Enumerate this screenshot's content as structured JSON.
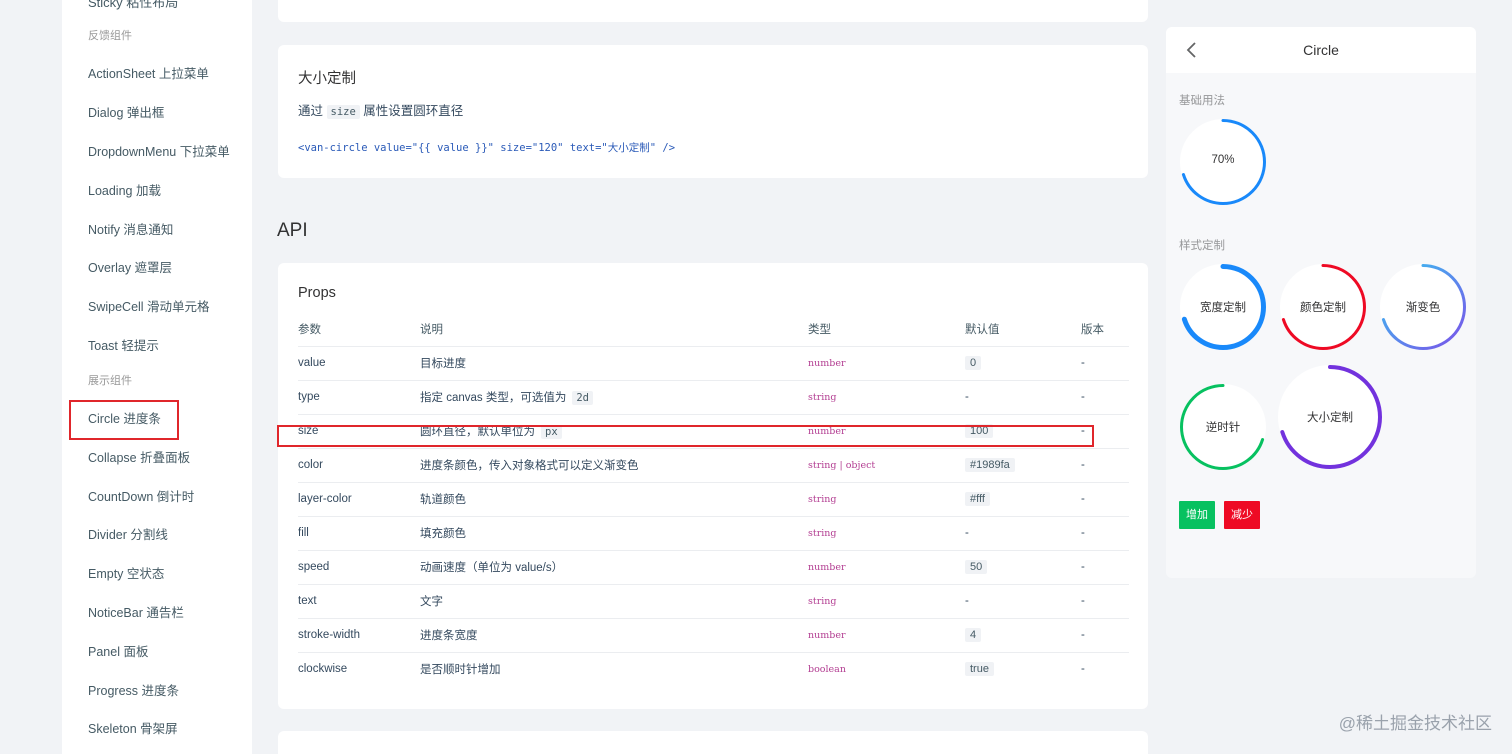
{
  "sidebar": {
    "top_item_clip": "Sticky 粘性布局",
    "group_feedback": "反馈组件",
    "feedback_items": [
      "ActionSheet 上拉菜单",
      "Dialog 弹出框",
      "DropdownMenu 下拉菜单",
      "Loading 加载",
      "Notify 消息通知",
      "Overlay 遮罩层",
      "SwipeCell 滑动单元格",
      "Toast 轻提示"
    ],
    "group_display": "展示组件",
    "display_items": [
      "Circle 进度条",
      "Collapse 折叠面板",
      "CountDown 倒计时",
      "Divider 分割线",
      "Empty 空状态",
      "NoticeBar 通告栏",
      "Panel 面板",
      "Progress 进度条",
      "Skeleton 骨架屏"
    ]
  },
  "size_card": {
    "title": "大小定制",
    "desc_prefix": "通过",
    "desc_code": "size",
    "desc_suffix": "属性设置圆环直径",
    "code": "<van-circle value=\"{{ value }}\" size=\"120\" text=\"大小定制\" />"
  },
  "api": {
    "title": "API",
    "props_title": "Props",
    "headers": [
      "参数",
      "说明",
      "类型",
      "默认值",
      "版本"
    ],
    "rows": [
      {
        "name": "value",
        "desc": "目标进度",
        "desc_code": "",
        "type": "number",
        "default": "0",
        "default_chip": true,
        "version": "-"
      },
      {
        "name": "type",
        "desc": "指定 canvas 类型，可选值为",
        "desc_code": "2d",
        "type": "string",
        "default": "-",
        "default_chip": false,
        "version": "-"
      },
      {
        "name": "size",
        "desc": "圆环直径，默认单位为",
        "desc_code": "px",
        "type": "number",
        "default": "100",
        "default_chip": true,
        "version": "-"
      },
      {
        "name": "color",
        "desc": "进度条颜色，传入对象格式可以定义渐变色",
        "desc_code": "",
        "type": "string | object",
        "default": "#1989fa",
        "default_chip": true,
        "version": "-"
      },
      {
        "name": "layer-color",
        "desc": "轨道颜色",
        "desc_code": "",
        "type": "string",
        "default": "#fff",
        "default_chip": true,
        "version": "-"
      },
      {
        "name": "fill",
        "desc": "填充颜色",
        "desc_code": "",
        "type": "string",
        "default": "-",
        "default_chip": false,
        "version": "-"
      },
      {
        "name": "speed",
        "desc": "动画速度（单位为 value/s）",
        "desc_code": "",
        "type": "number",
        "default": "50",
        "default_chip": true,
        "version": "-"
      },
      {
        "name": "text",
        "desc": "文字",
        "desc_code": "",
        "type": "string",
        "default": "-",
        "default_chip": false,
        "version": "-"
      },
      {
        "name": "stroke-width",
        "desc": "进度条宽度",
        "desc_code": "",
        "type": "number",
        "default": "4",
        "default_chip": true,
        "version": "-"
      },
      {
        "name": "clockwise",
        "desc": "是否顺时针增加",
        "desc_code": "",
        "type": "boolean",
        "default": "true",
        "default_chip": true,
        "version": "-"
      }
    ]
  },
  "phone": {
    "title": "Circle",
    "back_icon": "chevron-left-icon",
    "section_basic": "基础用法",
    "section_custom": "样式定制",
    "circles": [
      {
        "text": "70%",
        "value": 70,
        "color": "#1989fa"
      },
      {
        "text": "宽度定制",
        "value": 70,
        "color": "#1989fa"
      },
      {
        "text": "颜色定制",
        "value": 70,
        "color": "#ee0a24"
      },
      {
        "text": "渐变色",
        "value": 70,
        "color": "#6f6ef6"
      },
      {
        "text": "逆时针",
        "value": 70,
        "color": "#07c160"
      },
      {
        "text": "大小定制",
        "value": 70,
        "color": "#7232dd"
      }
    ],
    "btn_add": "增加",
    "btn_sub": "减少",
    "colors": {
      "add": "#07c160",
      "sub": "#ee0a24"
    }
  },
  "watermark": "@稀土掘金技术社区"
}
